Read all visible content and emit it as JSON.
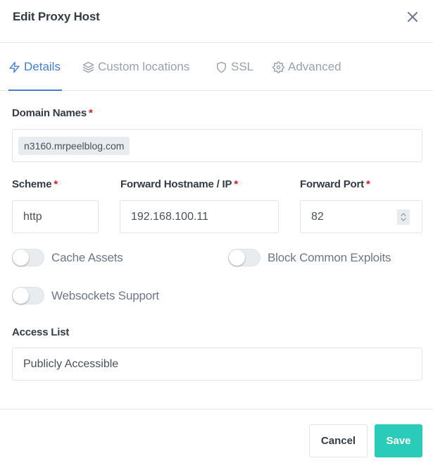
{
  "modal": {
    "title": "Edit Proxy Host",
    "close_icon": "close-icon"
  },
  "tabs": [
    {
      "label": "Details",
      "icon": "zap-icon",
      "active": true
    },
    {
      "label": "Custom locations",
      "icon": "layers-icon",
      "active": false
    },
    {
      "label": "SSL",
      "icon": "shield-icon",
      "active": false
    },
    {
      "label": "Advanced",
      "icon": "gear-icon",
      "active": false
    }
  ],
  "form": {
    "required_marker": "*",
    "domain_names": {
      "label": "Domain Names",
      "values": [
        "n3160.mrpeelblog.com"
      ]
    },
    "scheme": {
      "label": "Scheme",
      "value": "http"
    },
    "forward_hostname": {
      "label": "Forward Hostname / IP",
      "value": "192.168.100.11"
    },
    "forward_port": {
      "label": "Forward Port",
      "value": "82"
    },
    "toggles": [
      {
        "label": "Cache Assets",
        "checked": false
      },
      {
        "label": "Block Common Exploits",
        "checked": false
      },
      {
        "label": "Websockets Support",
        "checked": false
      }
    ],
    "access_list": {
      "label": "Access List",
      "value": "Publicly Accessible"
    }
  },
  "footer": {
    "cancel_label": "Cancel",
    "save_label": "Save"
  },
  "colors": {
    "accent": "#467fcf",
    "save": "#2bcbba",
    "required": "#cd201f"
  }
}
